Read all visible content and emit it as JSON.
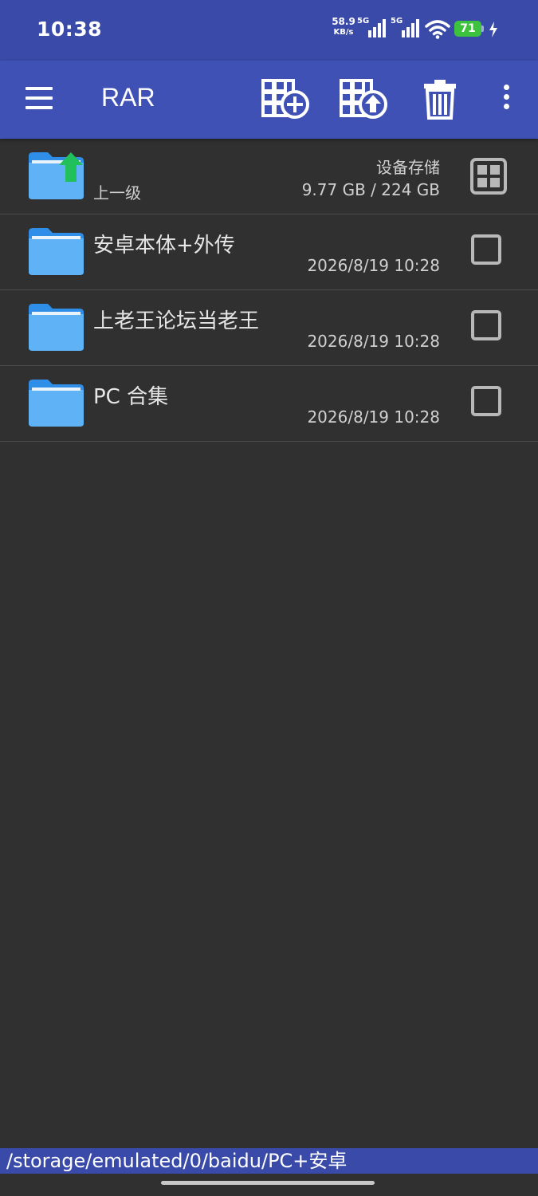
{
  "status": {
    "time": "10:38",
    "net_speed_value": "58.9",
    "net_speed_unit": "KB/s",
    "sim1_label": "5G",
    "sim2_label": "5G",
    "battery": "71",
    "battery_color": "#3dc23d",
    "icons": [
      "signal-icon",
      "wifi-icon",
      "battery-icon",
      "charging-icon"
    ]
  },
  "toolbar": {
    "title": "RAR",
    "color": "#3f51b5",
    "icons": [
      "menu-icon",
      "archive-add-icon",
      "archive-extract-icon",
      "trash-icon",
      "more-vert-icon"
    ]
  },
  "parent_row": {
    "label": "上一级",
    "storage_label": "设备存储",
    "storage_usage": "9.77 GB / 224 GB"
  },
  "files": [
    {
      "name": "安卓本体+外传",
      "date": "2026/8/19 10:28"
    },
    {
      "name": "上老王论坛当老王",
      "date": "2026/8/19 10:28"
    },
    {
      "name": "PC 合集",
      "date": "2026/8/19 10:28"
    }
  ],
  "path": "/storage/emulated/0/baidu/PC+安卓"
}
